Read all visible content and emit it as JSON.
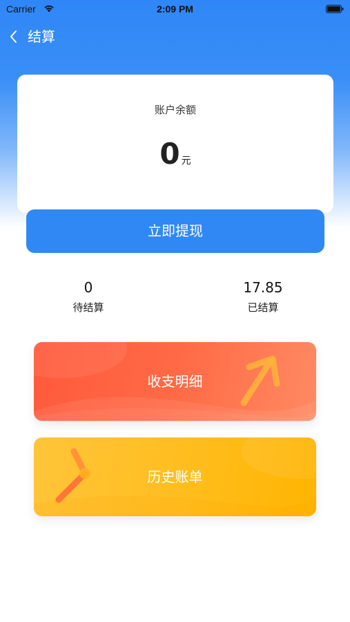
{
  "status_bar": {
    "carrier": "Carrier",
    "time": "2:09 PM"
  },
  "nav": {
    "back_icon": "chevron-left-icon",
    "title": "结算"
  },
  "balance": {
    "label": "账户余额",
    "value": "0",
    "unit": "元"
  },
  "withdraw_button": {
    "label": "立即提现"
  },
  "stats": {
    "pending": {
      "value": "0",
      "label": "待结算"
    },
    "settled": {
      "value": "17.85",
      "label": "已结算"
    }
  },
  "actions": {
    "details": {
      "label": "收支明细",
      "icon": "arrow-up-right-icon"
    },
    "history": {
      "label": "历史账单",
      "icon": "clock-hands-icon"
    }
  },
  "colors": {
    "primary": "#3088f4",
    "details_card": "#ff5a3c",
    "history_card": "#ffbe20"
  }
}
